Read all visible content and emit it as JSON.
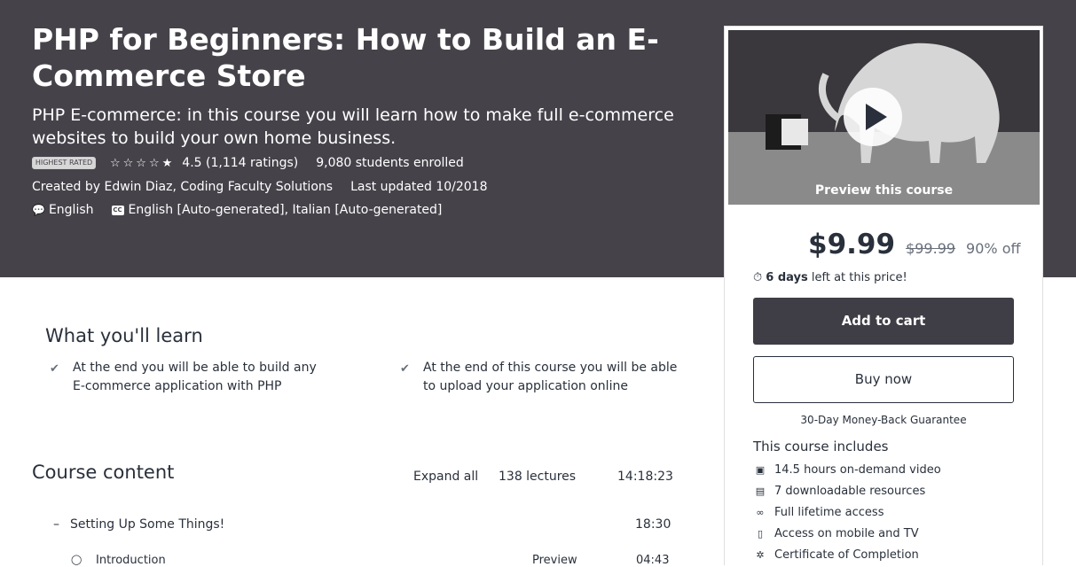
{
  "course": {
    "title": "PHP for Beginners: How to Build an E-Commerce Store",
    "subtitle": "PHP E-commerce: in this course you will learn how to make full e-commerce websites to build your own home business.",
    "badge": "HIGHEST RATED",
    "stars": "☆☆☆☆★",
    "rating_text": "4.5 (1,114 ratings)",
    "enrolled": "9,080 students enrolled",
    "created_by": "Created by Edwin Diaz, Coding Faculty Solutions",
    "last_updated": "Last updated 10/2018",
    "language": "English",
    "captions": "English [Auto-generated], Italian [Auto-generated]"
  },
  "sidebar": {
    "preview_label": "Preview this course",
    "price": "$9.99",
    "original_price": "$99.99",
    "discount": "90% off",
    "timer_bold": "6 days",
    "timer_rest": " left at this price!",
    "add_to_cart": "Add to cart",
    "buy_now": "Buy now",
    "guarantee": "30-Day Money-Back Guarantee",
    "includes_title": "This course includes",
    "includes": [
      {
        "icon": "video-icon",
        "label": "14.5 hours on-demand video"
      },
      {
        "icon": "file-icon",
        "label": "7 downloadable resources"
      },
      {
        "icon": "infinity-icon",
        "label": "Full lifetime access"
      },
      {
        "icon": "mobile-icon",
        "label": "Access on mobile and TV"
      },
      {
        "icon": "certificate-icon",
        "label": "Certificate of Completion"
      }
    ]
  },
  "learn": {
    "title": "What you'll learn",
    "items": [
      "At the end you will be able to build any E-commerce application with PHP",
      "At the end of this course you will be able to upload your application online"
    ]
  },
  "content": {
    "title": "Course content",
    "expand_all": "Expand all",
    "lectures": "138 lectures",
    "total_time": "14:18:23",
    "sections": [
      {
        "title": "Setting Up Some Things!",
        "time": "18:30"
      }
    ],
    "lectures_list": [
      {
        "title": "Introduction",
        "preview": "Preview",
        "time": "04:43"
      }
    ]
  },
  "colors": {
    "hero_bg": "#46424a",
    "cart_bg": "#3f3d45",
    "text": "#29303b"
  }
}
